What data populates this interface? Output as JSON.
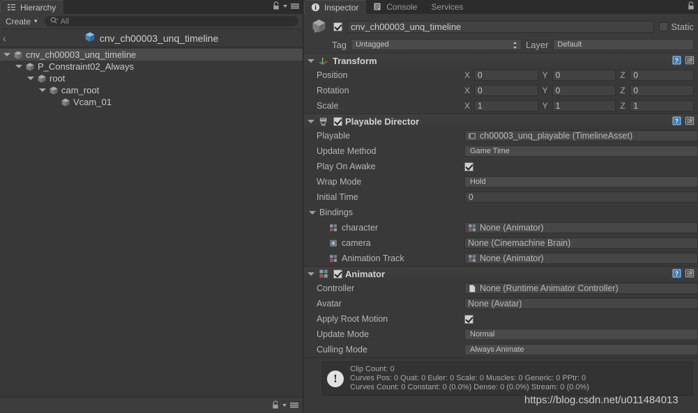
{
  "hierarchy": {
    "tab": {
      "label": "Hierarchy",
      "icon": "hierarchy-icon"
    },
    "toolbar": {
      "create_label": "Create",
      "create_arrow": "▾",
      "search_placeholder": "All",
      "search_value": "",
      "search_icon": "search-icon"
    },
    "breadcrumb": {
      "back_glyph": "‹",
      "label": "cnv_ch00003_unq_timeline",
      "icon": "prefab-cube-icon"
    },
    "tree": [
      {
        "label": "cnv_ch00003_unq_timeline",
        "depth": 0,
        "expanded": true,
        "selected": true
      },
      {
        "label": "P_Constraint02_Always",
        "depth": 1,
        "expanded": true,
        "selected": false
      },
      {
        "label": "root",
        "depth": 2,
        "expanded": true,
        "selected": false
      },
      {
        "label": "cam_root",
        "depth": 3,
        "expanded": true,
        "selected": false
      },
      {
        "label": "Vcam_01",
        "depth": 4,
        "expanded": false,
        "selected": false
      }
    ]
  },
  "inspector": {
    "tabs": [
      {
        "label": "Inspector",
        "icon": "info-icon",
        "active": true
      },
      {
        "label": "Console",
        "icon": "console-icon",
        "active": false
      },
      {
        "label": "Services",
        "icon": "",
        "active": false
      }
    ],
    "gameobject": {
      "enabled": true,
      "name": "cnv_ch00003_unq_timeline",
      "static_label": "Static",
      "static_checked": false,
      "tag_label": "Tag",
      "tag_value": "Untagged",
      "layer_label": "Layer",
      "layer_value": "Default"
    },
    "components": [
      {
        "name": "Transform",
        "icon": "transform-icon",
        "expanded": true,
        "has_toggle": false,
        "rows": [
          {
            "type": "vec3",
            "label": "Position",
            "x": "0",
            "y": "0",
            "z": "0"
          },
          {
            "type": "vec3",
            "label": "Rotation",
            "x": "0",
            "y": "0",
            "z": "0"
          },
          {
            "type": "vec3",
            "label": "Scale",
            "x": "1",
            "y": "1",
            "z": "1"
          }
        ]
      },
      {
        "name": "Playable Director",
        "icon": "playable-director-icon",
        "expanded": true,
        "has_toggle": true,
        "enabled": true,
        "rows": [
          {
            "type": "object",
            "label": "Playable",
            "value": "ch00003_unq_playable (TimelineAsset)",
            "value_icon": "timeline-asset-icon"
          },
          {
            "type": "enum",
            "label": "Update Method",
            "value": "Game Time"
          },
          {
            "type": "bool",
            "label": "Play On Awake",
            "value": true
          },
          {
            "type": "enum",
            "label": "Wrap Mode",
            "value": "Hold"
          },
          {
            "type": "text",
            "label": "Initial Time",
            "value": "0"
          },
          {
            "type": "foldout",
            "label": "Bindings",
            "expanded": true
          },
          {
            "type": "object",
            "label": "character",
            "label_icon": "animator-icon",
            "indent": true,
            "value": "None (Animator)",
            "value_icon": "animator-icon"
          },
          {
            "type": "object",
            "label": "camera",
            "label_icon": "camera-icon",
            "indent": true,
            "value": "None (Cinemachine Brain)",
            "value_icon": ""
          },
          {
            "type": "object",
            "label": "Animation Track",
            "label_icon": "animator-icon",
            "indent": true,
            "value": "None (Animator)",
            "value_icon": "animator-icon"
          }
        ]
      },
      {
        "name": "Animator",
        "icon": "animator-icon",
        "expanded": true,
        "has_toggle": true,
        "enabled": true,
        "rows": [
          {
            "type": "object",
            "label": "Controller",
            "value": "None (Runtime Animator Controller)",
            "value_icon": "asset-file-icon"
          },
          {
            "type": "object",
            "label": "Avatar",
            "value": "None (Avatar)",
            "value_icon": ""
          },
          {
            "type": "bool",
            "label": "Apply Root Motion",
            "value": true
          },
          {
            "type": "enum",
            "label": "Update Mode",
            "value": "Normal"
          },
          {
            "type": "enum",
            "label": "Culling Mode",
            "value": "Always Animate"
          }
        ]
      }
    ],
    "helpbox": {
      "icon": "warning-icon",
      "line1": "Clip Count: 0",
      "line2": "Curves Pos: 0 Quat: 0 Euler: 0 Scale: 0 Muscles: 0 Generic: 0 PPtr: 0",
      "line3": "Curves Count: 0 Constant: 0 (0.0%) Dense: 0 (0.0%) Stream: 0 (0.0%)"
    }
  },
  "watermark": {
    "text": "https://blog.csdn.net/u011484013"
  },
  "window_icons": {
    "lock": "lock-icon",
    "menu": "hamburger-menu-icon",
    "dropdown": "chevron-down-icon",
    "help": "help-icon",
    "preset": "preset-icon"
  },
  "colors": {
    "panel_bg": "#393939",
    "tab_bg": "#2c2c2c",
    "tab_active": "#3c3c3c",
    "field_bg": "#424242",
    "selection": "#4b4b4b",
    "text": "#b7b7b7",
    "prefab_blue": "#4a9ad4"
  }
}
